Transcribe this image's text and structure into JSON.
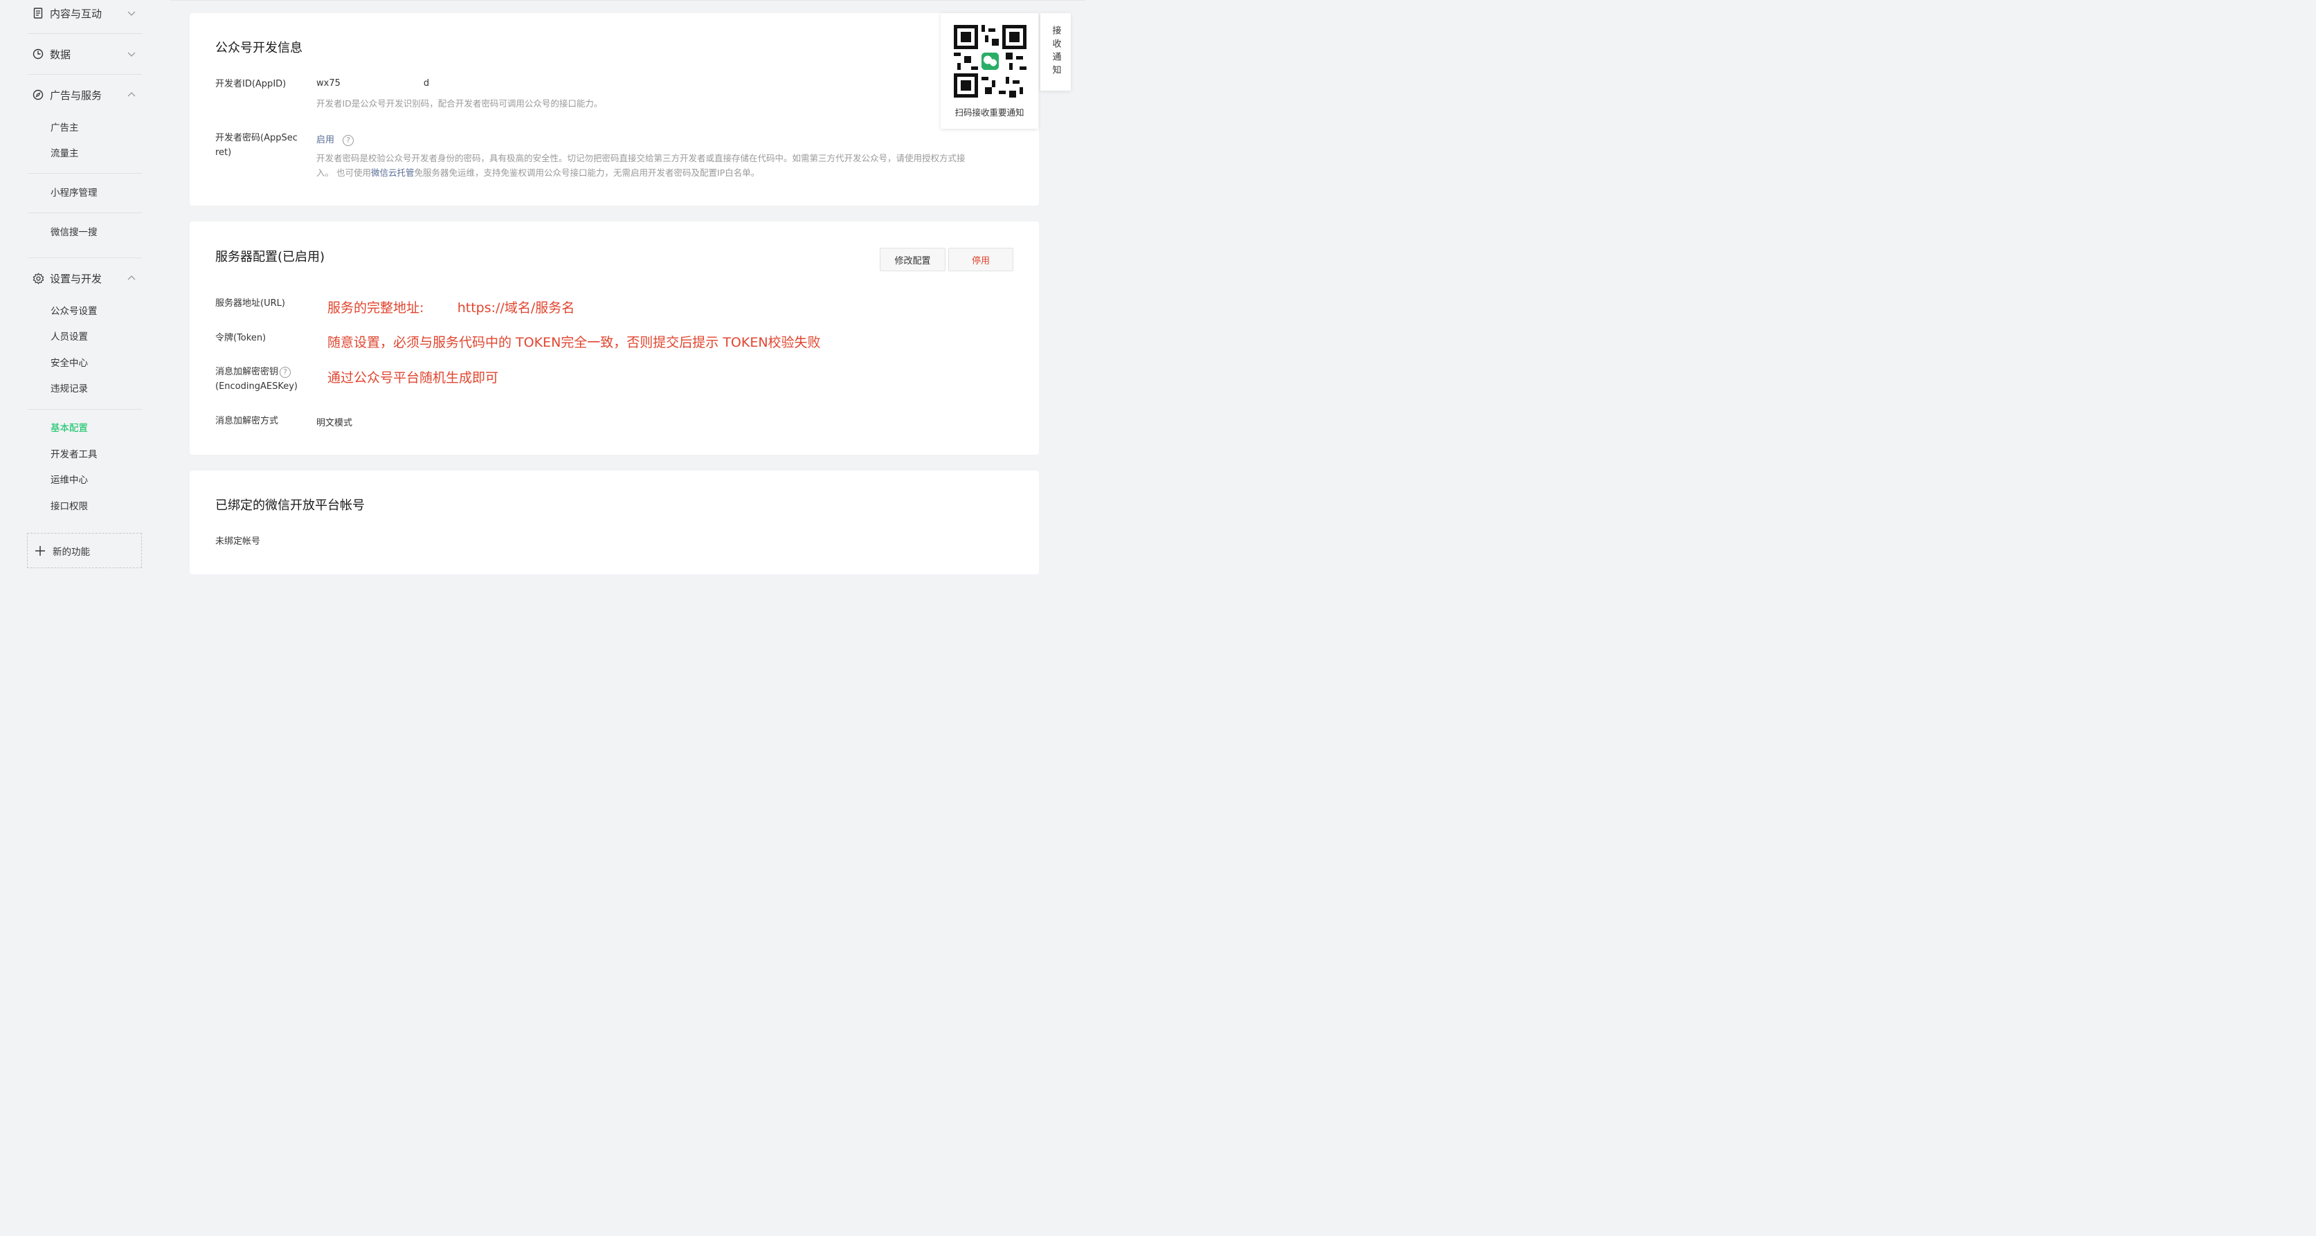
{
  "sidebar": {
    "groups": [
      {
        "label": "内容与互动",
        "icon": "document-icon",
        "expanded": false
      },
      {
        "label": "数据",
        "icon": "pie-chart-icon",
        "expanded": false
      },
      {
        "label": "广告与服务",
        "icon": "compass-icon",
        "expanded": true
      },
      {
        "label": "设置与开发",
        "icon": "gear-icon",
        "expanded": true
      }
    ],
    "ad_items": [
      "广告主",
      "流量主",
      "小程序管理",
      "微信搜一搜"
    ],
    "settings_items": [
      "公众号设置",
      "人员设置",
      "安全中心",
      "违规记录",
      "基本配置",
      "开发者工具",
      "运维中心",
      "接口权限"
    ],
    "active_item": "基本配置",
    "new_feature": "新的功能"
  },
  "dev_info": {
    "title": "公众号开发信息",
    "appid_label": "开发者ID(AppID)",
    "appid_value_start": "wx75",
    "appid_value_end": "d",
    "appid_desc": "开发者ID是公众号开发识别码，配合开发者密码可调用公众号的接口能力。",
    "secret_label_line1": "开发者密码(AppSec",
    "secret_label_line2": "ret)",
    "secret_action": "启用",
    "secret_desc_line1": "开发者密码是校验公众号开发者身份的密码，具有极高的安全性。切记勿把密码直接交给第三方开发者或直接存储在代码中。如需第三方代开发公众号，请使用授权方式接",
    "secret_desc_line2_a": "入。 也可使用",
    "secret_desc_link": "微信云托管",
    "secret_desc_line2_b": "免服务器免运维，支持免鉴权调用公众号接口能力，无需启用开发者密码及配置IP白名单。"
  },
  "server_config": {
    "title": "服务器配置(已启用)",
    "modify_button": "修改配置",
    "disable_button": "停用",
    "url_label": "服务器地址(URL)",
    "url_note": "服务的完整地址:        https://域名/服务名",
    "token_label": "令牌(Token)",
    "token_note": "随意设置，必须与服务代码中的 TOKEN完全一致，否则提交后提示 TOKEN校验失败",
    "aes_label_line1": "消息加解密密钥",
    "aes_label_line2": "(EncodingAESKey)",
    "aes_note": "通过公众号平台随机生成即可",
    "mode_label": "消息加解密方式",
    "mode_value": "明文模式"
  },
  "open_platform": {
    "title": "已绑定的微信开放平台帐号",
    "value": "未绑定帐号"
  },
  "notify": {
    "qr_caption": "扫码接收重要通知",
    "tab_label": "接收通知"
  },
  "colors": {
    "accent_green": "#07c160",
    "danger_red": "#e0452f",
    "link_blue": "#576b95"
  }
}
